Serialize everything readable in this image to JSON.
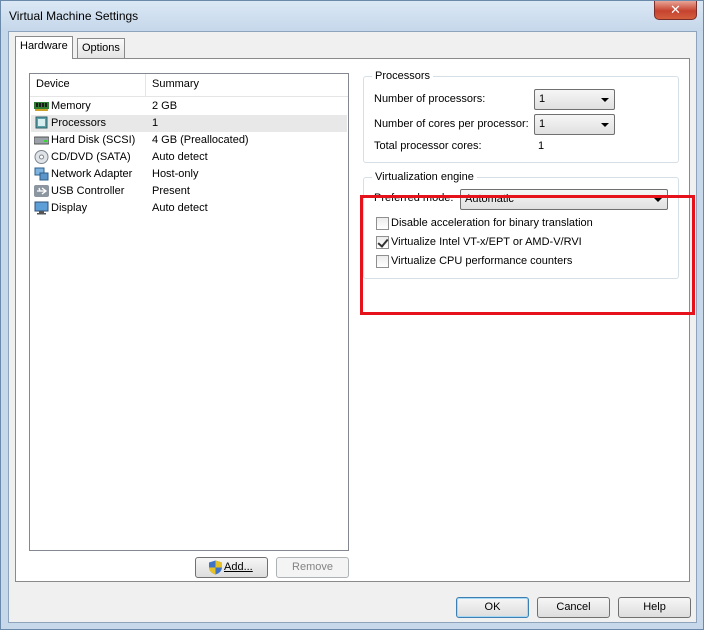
{
  "window": {
    "title": "Virtual Machine Settings",
    "close_label": "✕"
  },
  "tabs": [
    {
      "label": "Hardware",
      "active": true
    },
    {
      "label": "Options",
      "active": false
    }
  ],
  "device_list": {
    "columns": [
      "Device",
      "Summary"
    ],
    "rows": [
      {
        "icon": "memory-icon",
        "name": "Memory",
        "summary": "2 GB"
      },
      {
        "icon": "processor-icon",
        "name": "Processors",
        "summary": "1"
      },
      {
        "icon": "hard-disk-icon",
        "name": "Hard Disk (SCSI)",
        "summary": "4 GB (Preallocated)"
      },
      {
        "icon": "cd-dvd-icon",
        "name": "CD/DVD (SATA)",
        "summary": "Auto detect"
      },
      {
        "icon": "network-adapter-icon",
        "name": "Network Adapter",
        "summary": "Host-only"
      },
      {
        "icon": "usb-controller-icon",
        "name": "USB Controller",
        "summary": "Present"
      },
      {
        "icon": "display-icon",
        "name": "Display",
        "summary": "Auto detect"
      }
    ]
  },
  "list_buttons": {
    "add_label": "Add...",
    "remove_label": "Remove"
  },
  "processors": {
    "title": "Processors",
    "num_processors_label": "Number of processors:",
    "num_processors_value": "1",
    "cores_label": "Number of cores per processor:",
    "cores_value": "1",
    "total_label": "Total processor cores:",
    "total_value": "1"
  },
  "virtualization": {
    "title": "Virtualization engine",
    "mode_label": "Preferred mode:",
    "mode_value": "Automatic",
    "options": [
      {
        "label": "Disable acceleration for binary translation",
        "checked": false
      },
      {
        "label": "Virtualize Intel VT-x/EPT or AMD-V/RVI",
        "checked": true
      },
      {
        "label": "Virtualize CPU performance counters",
        "checked": false
      }
    ]
  },
  "footer": {
    "ok_label": "OK",
    "cancel_label": "Cancel",
    "help_label": "Help"
  },
  "colors": {
    "highlight": "#e5111b",
    "selection": "#e8e8e8"
  }
}
